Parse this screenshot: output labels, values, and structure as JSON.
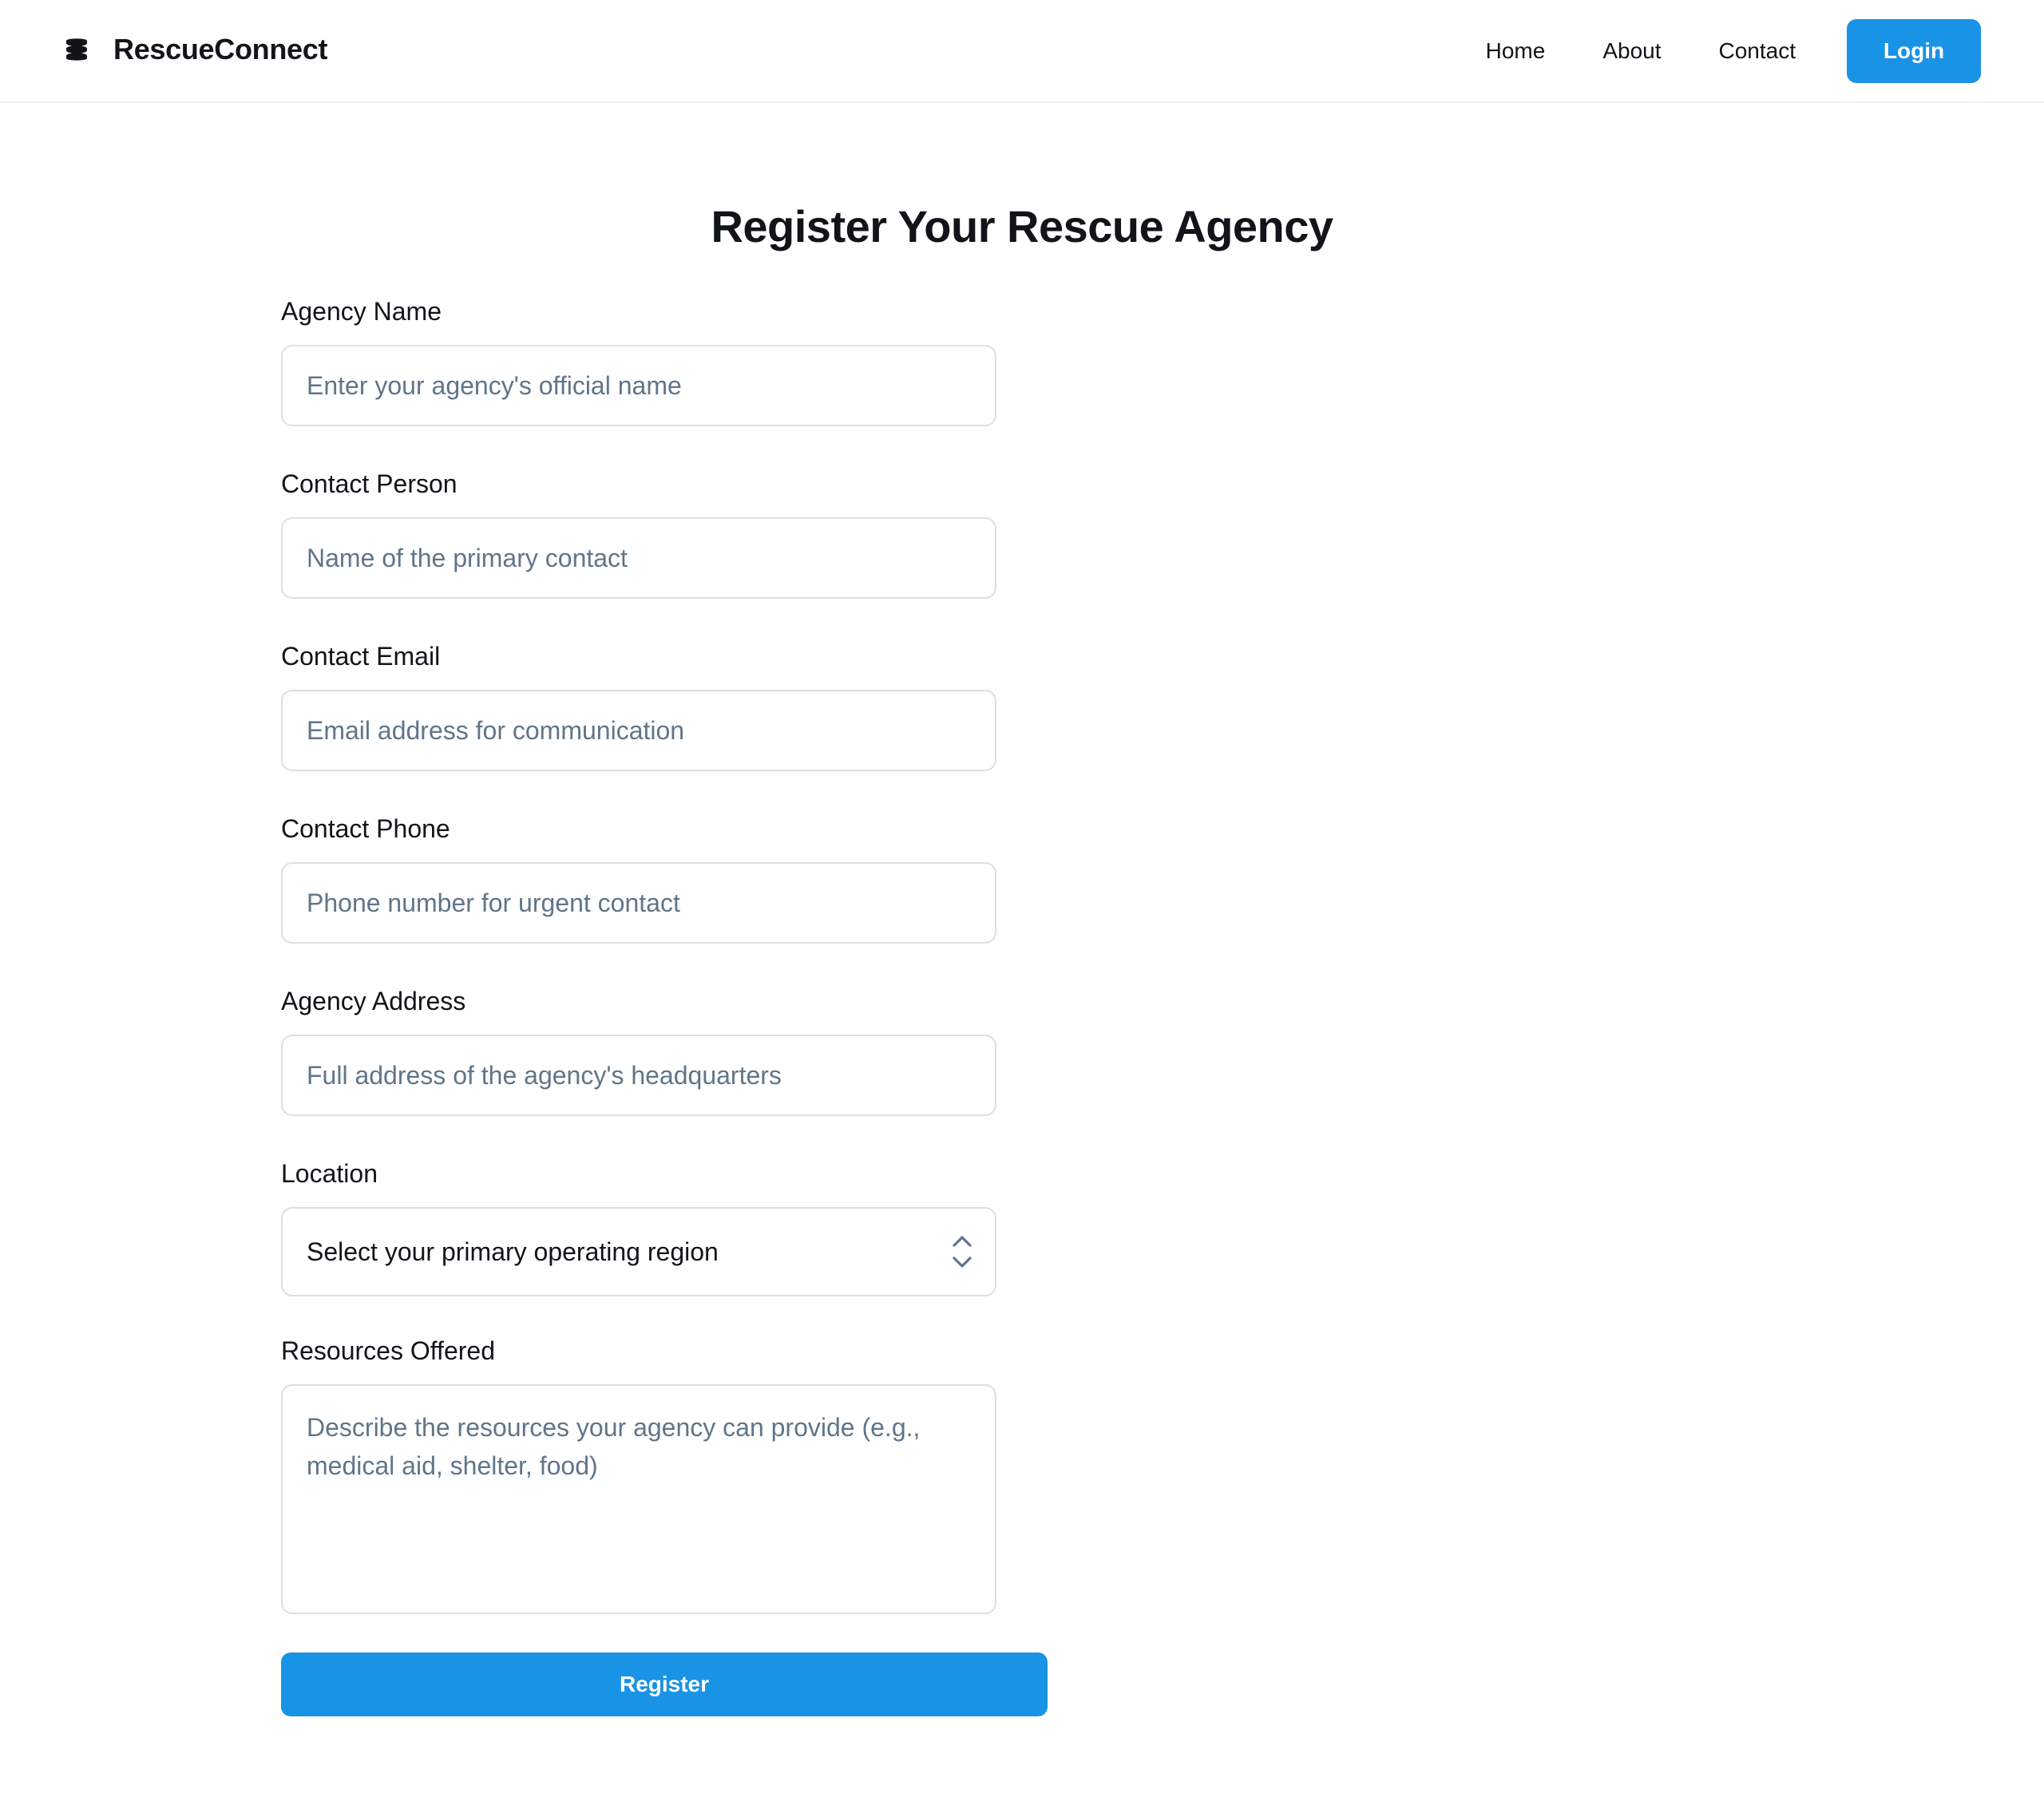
{
  "header": {
    "brand_name": "RescueConnect",
    "brand_icon": "stacked-layers-icon",
    "nav": {
      "home": "Home",
      "about": "About",
      "contact": "Contact"
    },
    "login_label": "Login"
  },
  "main": {
    "title": "Register Your Rescue Agency",
    "fields": {
      "agency_name": {
        "label": "Agency Name",
        "placeholder": "Enter your agency's official name",
        "value": ""
      },
      "contact_person": {
        "label": "Contact Person",
        "placeholder": "Name of the primary contact",
        "value": ""
      },
      "contact_email": {
        "label": "Contact Email",
        "placeholder": "Email address for communication",
        "value": ""
      },
      "contact_phone": {
        "label": "Contact Phone",
        "placeholder": "Phone number for urgent contact",
        "value": ""
      },
      "agency_address": {
        "label": "Agency Address",
        "placeholder": "Full address of the agency's headquarters",
        "value": ""
      },
      "location": {
        "label": "Location",
        "selected": "Select your primary operating region",
        "icon": "chevron-up-down-icon"
      },
      "resources": {
        "label": "Resources Offered",
        "placeholder": "Describe the resources your agency can provide (e.g., medical aid, shelter, food)",
        "value": ""
      }
    },
    "register_label": "Register"
  },
  "colors": {
    "accent": "#1993e5",
    "text": "#111418",
    "placeholder": "#60758a",
    "border": "#dbe0e5"
  }
}
